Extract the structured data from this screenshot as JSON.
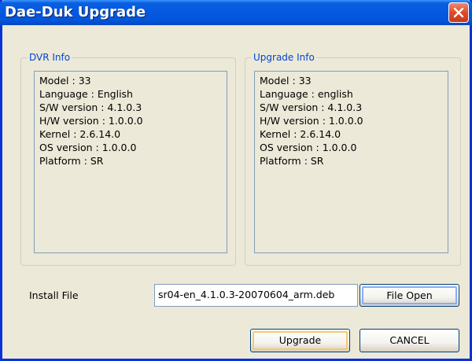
{
  "window": {
    "title": "Dae-Duk Upgrade"
  },
  "dvr_info": {
    "title": "DVR Info",
    "lines": [
      "Model : 33",
      "Language : English",
      "S/W version : 4.1.0.3",
      "H/W version : 1.0.0.0",
      "Kernel : 2.6.14.0",
      "OS version : 1.0.0.0",
      "Platform : SR"
    ]
  },
  "upgrade_info": {
    "title": "Upgrade Info",
    "lines": [
      "Model : 33",
      "Language : english",
      "S/W version : 4.1.0.3",
      "H/W version : 1.0.0.0",
      "Kernel : 2.6.14.0",
      "OS version : 1.0.0.0",
      "Platform : SR"
    ]
  },
  "install": {
    "label": "Install File",
    "value": "sr04-en_4.1.0.3-20070604_arm.deb",
    "open_label": "File Open"
  },
  "buttons": {
    "upgrade": "Upgrade",
    "cancel": "CANCEL"
  }
}
